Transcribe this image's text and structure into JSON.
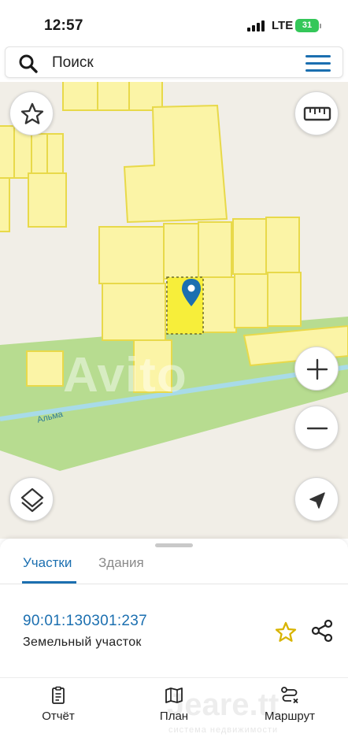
{
  "status_bar": {
    "time": "12:57",
    "network": "LTE",
    "battery": "31"
  },
  "search": {
    "label": "Поиск",
    "icon": "search-icon",
    "menu_icon": "hamburger-menu-icon"
  },
  "map": {
    "street_label": "Альма",
    "watermark": "Avito",
    "colors": {
      "background": "#f1eee7",
      "parcel_fill": "#fbf4a6",
      "parcel_stroke": "#e8d94a",
      "selected_fill": "#f7ee3a",
      "road": "#b7dc90",
      "river": "#a8dbe8",
      "marker": "#1b6fb0"
    },
    "controls": {
      "favorite_icon": "star-outline-icon",
      "ruler_icon": "ruler-icon",
      "zoom_in_icon": "plus-icon",
      "zoom_out_icon": "minus-icon",
      "layers_icon": "layers-icon",
      "locate_icon": "navigation-arrow-icon"
    }
  },
  "sheet": {
    "tabs": [
      {
        "label": "Участки",
        "active": true
      },
      {
        "label": "Здания",
        "active": false
      }
    ],
    "parcel": {
      "number": "90:01:130301:237",
      "type": "Земельный участок"
    },
    "accent": "#1b6fb0",
    "star_color": "#d8b400"
  },
  "bottom_nav": {
    "items": [
      {
        "label": "Отчёт",
        "icon": "report-icon"
      },
      {
        "label": "План",
        "icon": "map-icon"
      },
      {
        "label": "Маршрут",
        "icon": "route-icon"
      }
    ],
    "watermark": "Jeare.tt",
    "watermark_sub": "система недвижимости"
  }
}
